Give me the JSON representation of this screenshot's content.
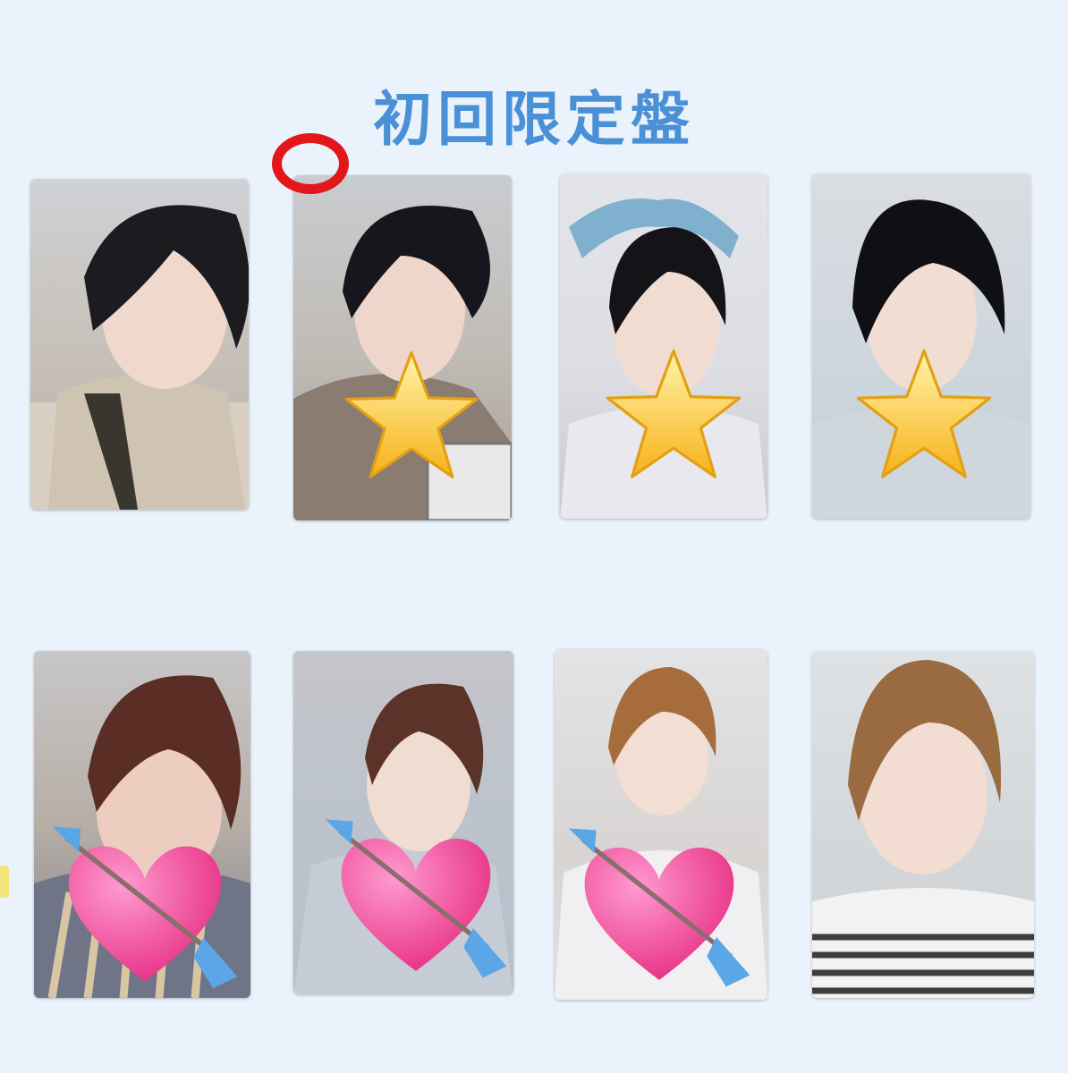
{
  "page": {
    "title": "初回限定盤"
  },
  "colors": {
    "background": "#eaf3fb",
    "title": "#4a90d6",
    "circle_mark": "#e3161b"
  },
  "rows": [
    {
      "cards": [
        {
          "photo": "photocard-portrait",
          "sticker": "none"
        },
        {
          "photo": "photocard-portrait",
          "sticker": "star",
          "marked": "red-circle"
        },
        {
          "photo": "photocard-portrait",
          "sticker": "star"
        },
        {
          "photo": "photocard-portrait",
          "sticker": "star"
        }
      ]
    },
    {
      "cards": [
        {
          "photo": "photocard-portrait",
          "sticker": "heart-arrow"
        },
        {
          "photo": "photocard-portrait",
          "sticker": "heart-arrow"
        },
        {
          "photo": "photocard-portrait",
          "sticker": "heart-arrow"
        },
        {
          "photo": "photocard-portrait",
          "sticker": "none"
        }
      ]
    }
  ],
  "icons": [
    "star-sticker-icon",
    "heart-arrow-sticker-icon",
    "red-circle-mark-icon"
  ]
}
